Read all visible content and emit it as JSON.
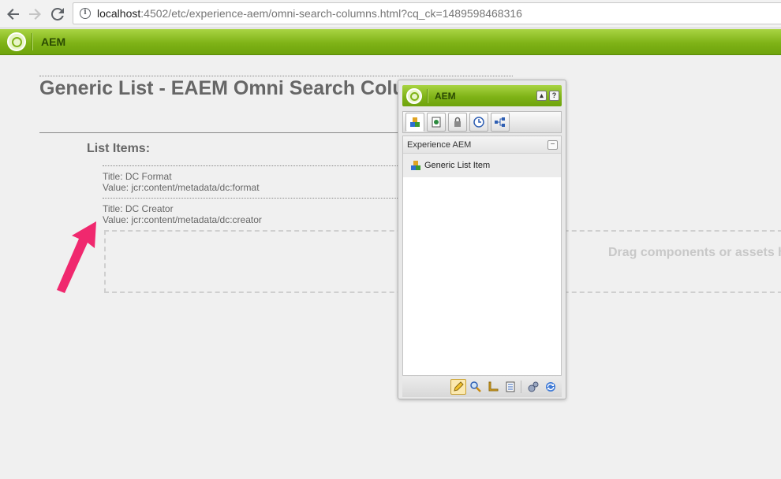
{
  "browser": {
    "url_host": "localhost",
    "url_rest": ":4502/etc/experience-aem/omni-search-columns.html?cq_ck=1489598468316"
  },
  "topbar": {
    "title": "AEM"
  },
  "page": {
    "title": "Generic List - EAEM Omni Search Columns",
    "list_heading": "List Items:",
    "items": [
      {
        "title": "Title: DC Format",
        "value": "Value: jcr:content/metadata/dc:format"
      },
      {
        "title": "Title: DC Creator",
        "value": "Value: jcr:content/metadata/dc:creator"
      }
    ],
    "drop_text": "Drag components or assets here"
  },
  "sidekick": {
    "title": "AEM",
    "header_buttons": [
      "▴",
      "?"
    ],
    "group_label": "Experience AEM",
    "component_label": "Generic List Item"
  },
  "colors": {
    "aem_green": "#7fb317",
    "arrow": "#f0286e"
  }
}
